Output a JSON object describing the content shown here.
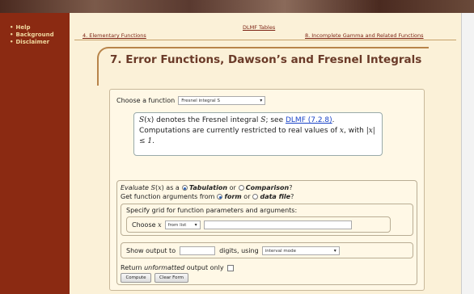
{
  "sidebar": {
    "items": [
      {
        "label": "Help"
      },
      {
        "label": "Background"
      },
      {
        "label": "Disclaimer"
      }
    ]
  },
  "topnav": {
    "prev": "4. Elementary Functions",
    "up": "DLMF Tables",
    "next": "8. Incomplete Gamma and Related Functions"
  },
  "page": {
    "title": "7. Error Functions, Dawson’s and Fresnel Integrals"
  },
  "form": {
    "choose_function_label": "Choose a function",
    "function_selected": "Fresnel integral S",
    "description_part1": "denotes the Fresnel integral",
    "description_part2": "; see",
    "description_link": "DLMF (7.2.8)",
    "description_part3": ". Computations are currently restricted to real values of",
    "description_part4": ", with",
    "description_part5": ".",
    "evaluate_label": "Evaluate",
    "as_a": "as a",
    "tabulation": "Tabulation",
    "or": "or",
    "comparison": "Comparison",
    "get_args_label": "Get function arguments from",
    "form_option": "form",
    "or2": "or",
    "data_file_option": "data file",
    "grid_title": "Specify grid for function parameters and arguments:",
    "choose_x_label": "Choose",
    "x_source_selected": "from list",
    "show_output_label": "Show output to",
    "digits_using": "digits, using",
    "mode_selected": "interval mode",
    "return_unformatted_prefix": "Return",
    "return_unformatted_italic": "unformatted",
    "return_unformatted_suffix": "output only",
    "compute_button": "Compute",
    "clear_button": "Clear Form"
  },
  "colors": {
    "sidebar_bg": "#8b2a12",
    "content_bg": "#fbf1d8",
    "title_color": "#6a3a28",
    "link_color": "#1a44c8"
  }
}
